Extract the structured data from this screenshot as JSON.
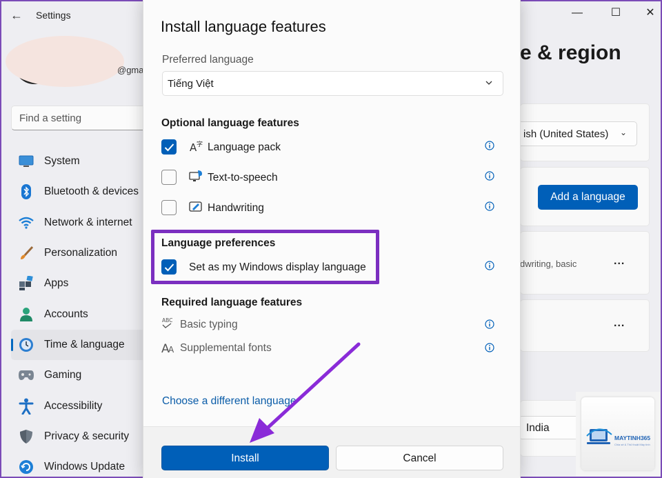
{
  "window": {
    "app_title": "Settings",
    "email_fragment": "@gma",
    "page_title_fragment": "e & region"
  },
  "search": {
    "placeholder": "Find a setting"
  },
  "sidebar": {
    "items": [
      {
        "label": "System",
        "icon": "monitor-icon",
        "active": false
      },
      {
        "label": "Bluetooth & devices",
        "icon": "bluetooth-icon",
        "active": false
      },
      {
        "label": "Network & internet",
        "icon": "wifi-icon",
        "active": false
      },
      {
        "label": "Personalization",
        "icon": "brush-icon",
        "active": false
      },
      {
        "label": "Apps",
        "icon": "apps-icon",
        "active": false
      },
      {
        "label": "Accounts",
        "icon": "person-icon",
        "active": false
      },
      {
        "label": "Time & language",
        "icon": "clock-globe-icon",
        "active": true
      },
      {
        "label": "Gaming",
        "icon": "gamepad-icon",
        "active": false
      },
      {
        "label": "Accessibility",
        "icon": "accessibility-icon",
        "active": false
      },
      {
        "label": "Privacy & security",
        "icon": "shield-icon",
        "active": false
      },
      {
        "label": "Windows Update",
        "icon": "update-icon",
        "active": false
      }
    ]
  },
  "background_cards": {
    "display_language_value": "ish (United States)",
    "add_language_label": "Add a language",
    "lang_row_sub": "dwriting, basic",
    "more_label": "...",
    "region_value": "India"
  },
  "dialog": {
    "title": "Install language features",
    "preferred_label": "Preferred language",
    "preferred_value": "Tiếng Việt",
    "optional_heading": "Optional language features",
    "optional_features": [
      {
        "label": "Language pack",
        "checked": true,
        "icon": "language-pack-icon"
      },
      {
        "label": "Text-to-speech",
        "checked": false,
        "icon": "text-to-speech-icon"
      },
      {
        "label": "Handwriting",
        "checked": false,
        "icon": "handwriting-icon"
      }
    ],
    "preferences_heading": "Language preferences",
    "display_language_option": {
      "label": "Set as my Windows display language",
      "checked": true
    },
    "required_heading": "Required language features",
    "required_features": [
      {
        "label": "Basic typing",
        "icon": "abc-typing-icon"
      },
      {
        "label": "Supplemental fonts",
        "icon": "fonts-icon"
      }
    ],
    "choose_link": "Choose a different language",
    "install_label": "Install",
    "cancel_label": "Cancel"
  },
  "watermark": {
    "brand": "MAYTINH365",
    "tagline": "Chia sẻ & Thủ thuật Máy tính"
  },
  "colors": {
    "accent": "#005fb8",
    "highlight": "#7b2fc0",
    "arrow": "#8a2bd8"
  }
}
